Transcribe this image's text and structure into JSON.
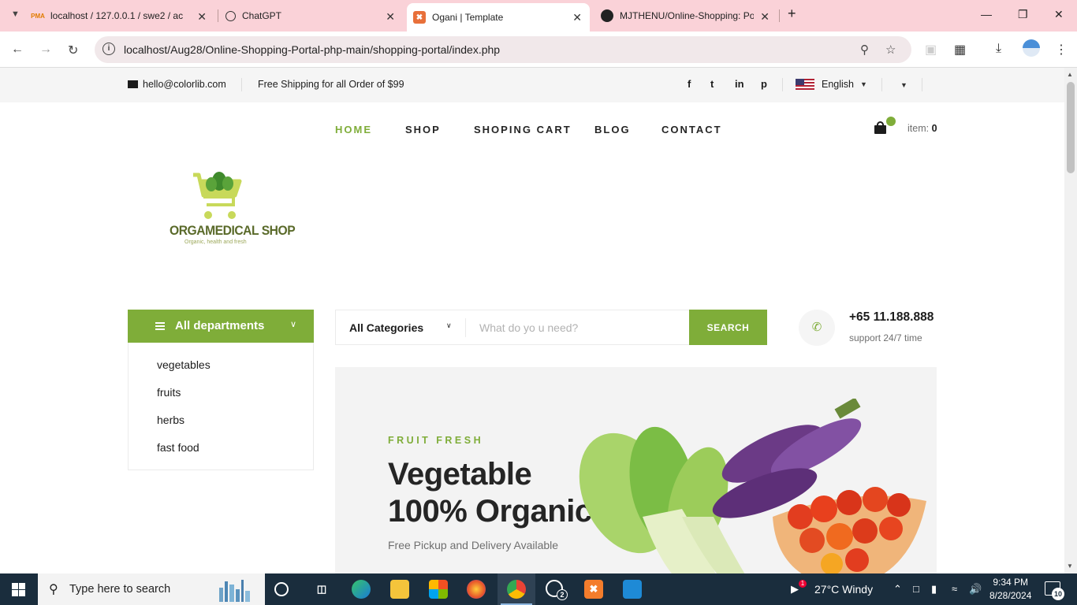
{
  "browser": {
    "tabs": [
      {
        "title": "localhost / 127.0.0.1 / swe2 / ac",
        "favicon": "PMA",
        "active": false
      },
      {
        "title": "ChatGPT",
        "favicon": "chatgpt-icon",
        "active": false
      },
      {
        "title": "Ogani | Template",
        "favicon": "xampp-icon",
        "active": true
      },
      {
        "title": "MJTHENU/Online-Shopping: Po",
        "favicon": "github-icon",
        "active": false
      }
    ],
    "url": "localhost/Aug28/Online-Shopping-Portal-php-main/shopping-portal/index.php"
  },
  "topbar": {
    "email": "hello@colorlib.com",
    "shipping": "Free Shipping for all Order of $99",
    "social": [
      "f",
      "t",
      "in",
      "p"
    ],
    "language": "English"
  },
  "nav": {
    "items": [
      "HOME",
      "SHOP",
      "SHOPING CART",
      "BLOG",
      "CONTACT"
    ],
    "active": "HOME",
    "cart_label": "item:",
    "cart_count": "0"
  },
  "logo": {
    "brand": "ORGAMEDICAL SHOP",
    "tagline": "Organic, health and fresh"
  },
  "departments": {
    "title": "All departments",
    "items": [
      "vegetables",
      "fruits",
      "herbs",
      "fast food"
    ]
  },
  "search": {
    "category": "All Categories",
    "placeholder": "What do yo u need?",
    "button": "SEARCH"
  },
  "contact": {
    "phone": "+65 11.188.888",
    "support": "support 24/7 time"
  },
  "hero": {
    "eyebrow": "FRUIT FRESH",
    "title_line1": "Vegetable",
    "title_line2": "100% Organic",
    "subtitle": "Free Pickup and Delivery Available"
  },
  "taskbar": {
    "search_placeholder": "Type here to search",
    "weather": "27°C  Windy",
    "time": "9:34 PM",
    "date": "8/28/2024",
    "notifications": "10",
    "whatsapp_badge": "2",
    "tray_badge": "1"
  },
  "colors": {
    "accent": "#7fad39",
    "tabbar": "#fad2d8",
    "taskbar": "#1a2d3d"
  }
}
